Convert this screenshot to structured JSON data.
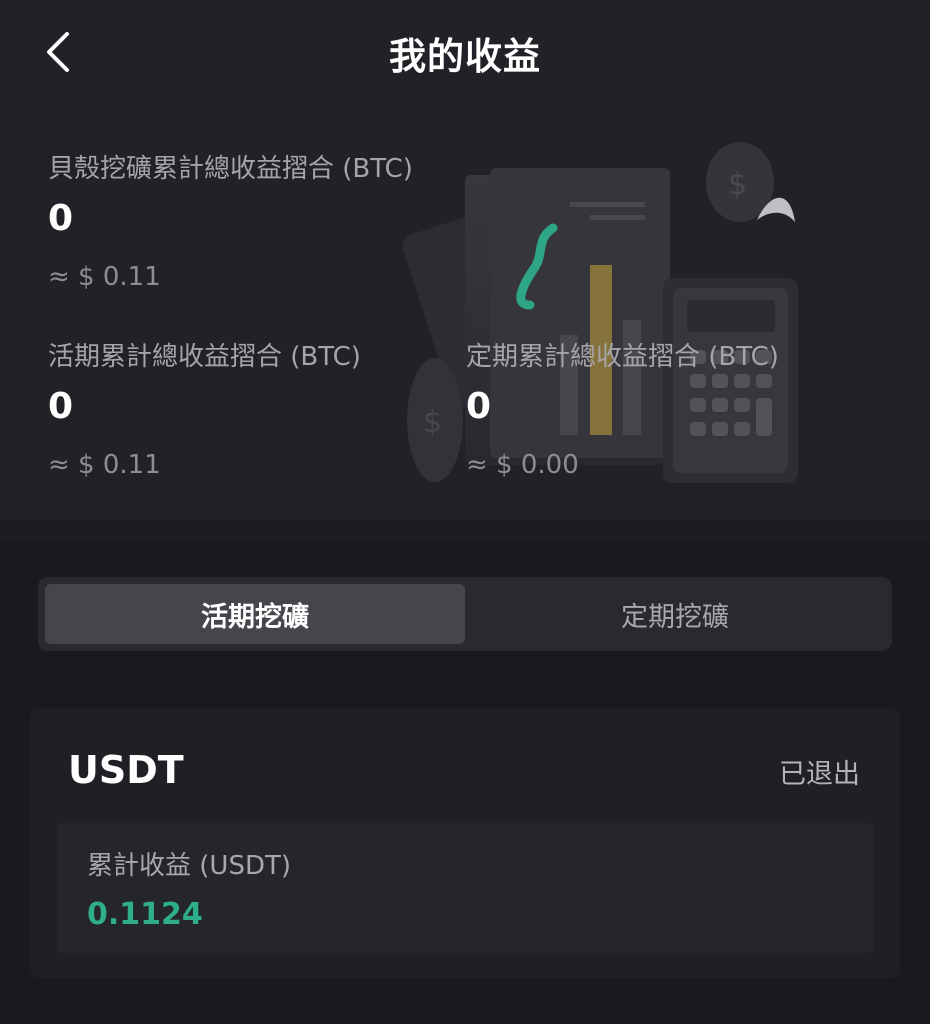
{
  "header": {
    "title": "我的收益"
  },
  "summary": {
    "total": {
      "label": "貝殼挖礦累計總收益摺合 (BTC)",
      "value": "0",
      "approx": "≈ $ 0.11"
    },
    "flexible": {
      "label": "活期累計總收益摺合 (BTC)",
      "value": "0",
      "approx": "≈ $ 0.11"
    },
    "fixed": {
      "label": "定期累計總收益摺合 (BTC)",
      "value": "0",
      "approx": "≈ $ 0.00"
    }
  },
  "tabs": [
    {
      "label": "活期挖礦",
      "active": true
    },
    {
      "label": "定期挖礦",
      "active": false
    }
  ],
  "card": {
    "coin": "USDT",
    "status": "已退出",
    "earn_label": "累計收益 (USDT)",
    "earn_value": "0.1124"
  },
  "colors": {
    "accent_green": "#2fae8c",
    "background": "#1a191e",
    "panel": "#222127"
  },
  "icons": {
    "back": "chevron-left-icon"
  }
}
